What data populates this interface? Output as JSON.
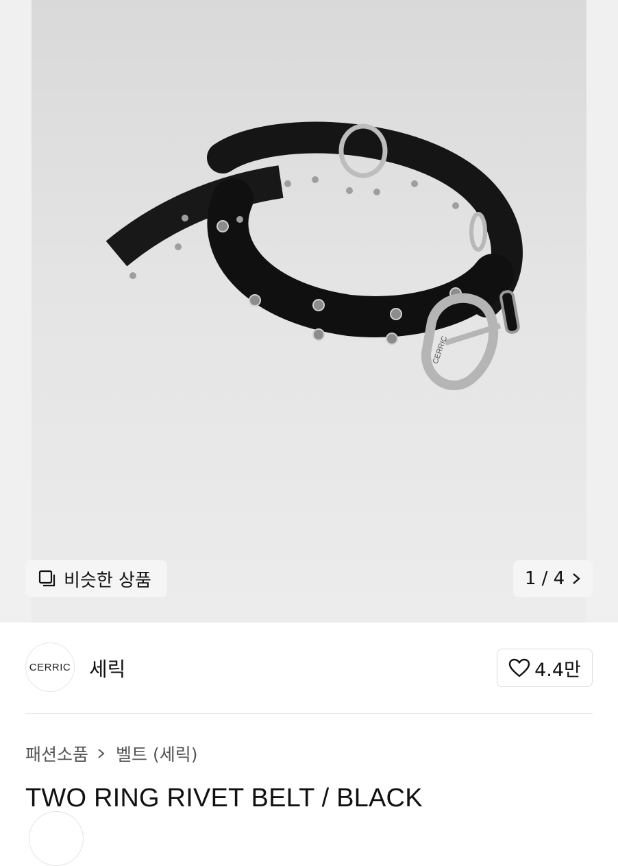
{
  "gallery": {
    "similar_label": "비슷한 상품",
    "pager": "1 / 4",
    "image_logo_text": "CERRIC"
  },
  "brand": {
    "logo_text": "CERRIC",
    "name": "세릭",
    "likes": "4.4만"
  },
  "breadcrumb": {
    "category": "패션소품",
    "subcategory": "벨트 (세릭)"
  },
  "product": {
    "title": "TWO RING RIVET BELT / BLACK"
  },
  "icons": {
    "similar": "similar-products-icon",
    "next": "chevron-right-icon",
    "like": "heart-icon",
    "crumb_sep": "chevron-right-icon"
  }
}
